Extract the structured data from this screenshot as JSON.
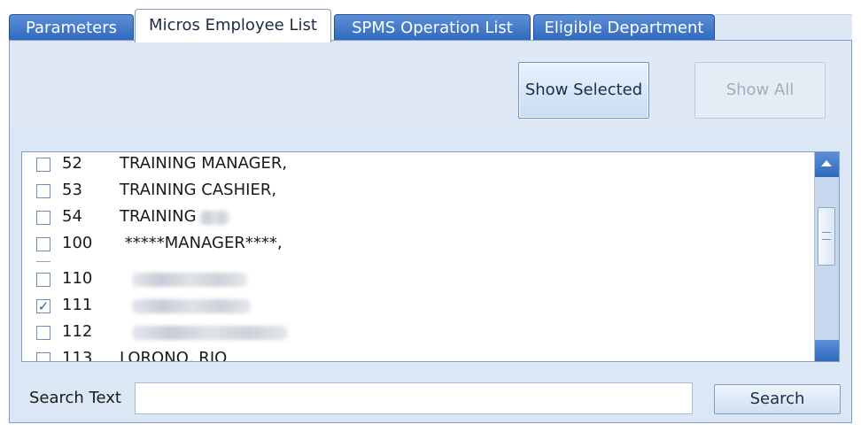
{
  "tabs": [
    {
      "label": "Parameters",
      "active": false
    },
    {
      "label": "Micros Employee List",
      "active": true
    },
    {
      "label": "SPMS Operation List",
      "active": false
    },
    {
      "label": "Eligible Department",
      "active": false
    }
  ],
  "toolbar": {
    "show_selected_label": "Show Selected",
    "show_all_label": "Show All"
  },
  "employees": [
    {
      "number": "52",
      "name": "TRAINING MANAGER,",
      "checked": false
    },
    {
      "number": "53",
      "name": "TRAINING CASHIER,",
      "checked": false
    },
    {
      "number": "54",
      "name": "TRAINING",
      "checked": false
    },
    {
      "number": "100",
      "name": " *****MANAGER****,",
      "checked": false
    },
    {
      "number": "110",
      "name": "",
      "checked": false
    },
    {
      "number": "111",
      "name": "",
      "checked": true
    },
    {
      "number": "112",
      "name": "",
      "checked": false
    },
    {
      "number": "113",
      "name": "LORONO, RIO",
      "checked": false
    }
  ],
  "search": {
    "label": "Search Text",
    "value": "",
    "button_label": "Search"
  },
  "colors": {
    "tab_blue": "#3a73c4",
    "panel_bg": "#dce7f5",
    "border": "#7f9ec8"
  }
}
